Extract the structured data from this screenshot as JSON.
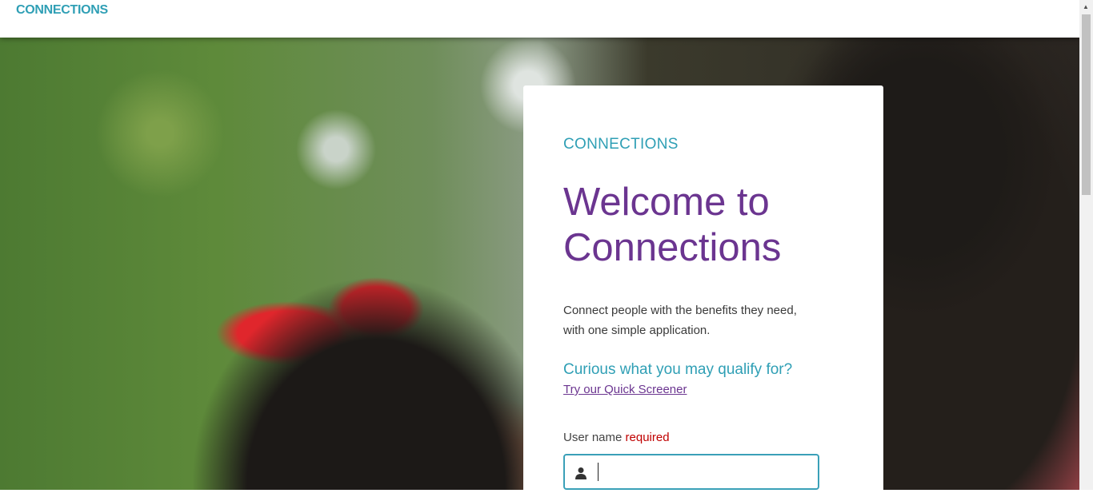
{
  "header": {
    "brand": "CONNECTIONS"
  },
  "card": {
    "kicker": "CONNECTIONS",
    "title": "Welcome to Connections",
    "description": "Connect people with the benefits they need, with one simple application.",
    "curious": "Curious what you may qualify for?",
    "screener_link": "Try our Quick Screener",
    "username_label": "User name",
    "username_required": "required",
    "username_value": ""
  },
  "colors": {
    "brand": "#2f9fb5",
    "title": "#6b3590",
    "required": "#c00000"
  }
}
